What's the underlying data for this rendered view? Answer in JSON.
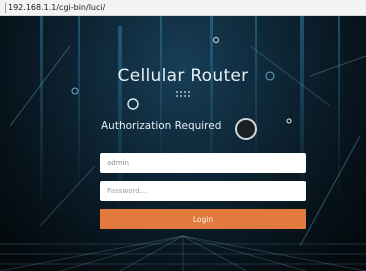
{
  "browser": {
    "url": "192.168.1.1/cgi-bin/luci/"
  },
  "login": {
    "title": "Cellular Router",
    "heading": "Authorization Required",
    "username_value": "admin",
    "password_placeholder": "Password...",
    "submit_label": "Login",
    "accent_color": "#e27a3d"
  }
}
